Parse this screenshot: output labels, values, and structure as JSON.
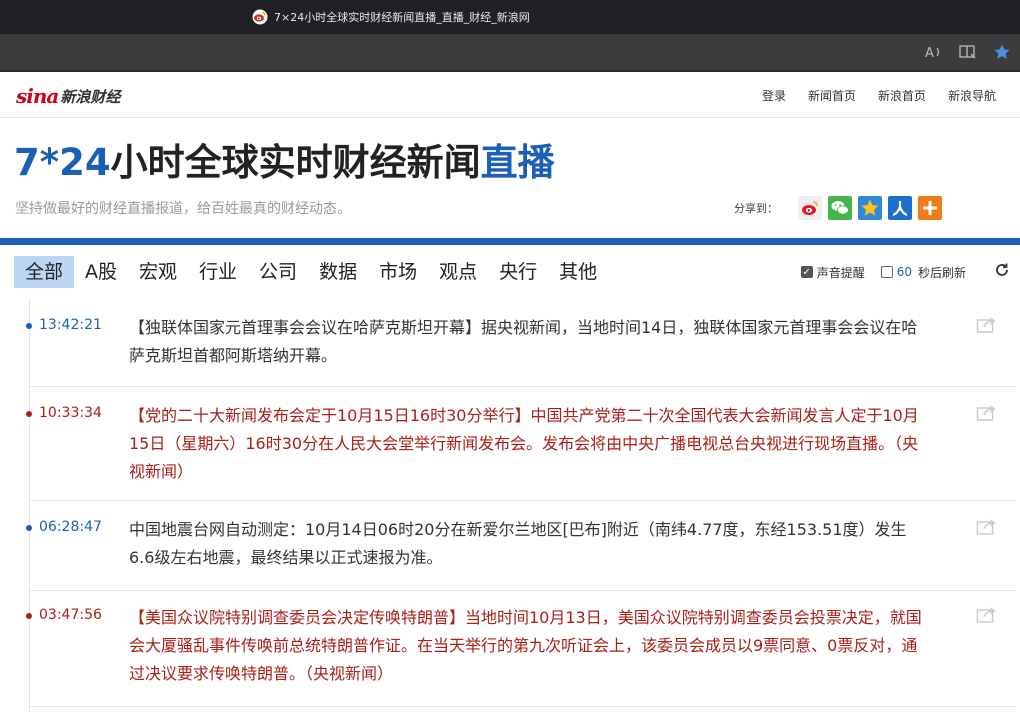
{
  "browser": {
    "tab_title": "7×24小时全球实时财经新闻直播_直播_财经_新浪网",
    "icons": [
      "read-aloud-icon",
      "immersive-reader-icon",
      "favorite-star-icon"
    ]
  },
  "header": {
    "logo_sina": "sina",
    "logo_text": "新浪财经",
    "nav": [
      "登录",
      "新闻首页",
      "新浪首页",
      "新浪导航"
    ]
  },
  "hero": {
    "title_part1": "7*24",
    "title_part2": "小时全球实时财经新闻",
    "title_part3": "直播",
    "subtitle": "坚持做最好的财经直播报道，给百姓最真的财经动态。",
    "share_label": "分享到：",
    "share_targets": [
      {
        "name": "weibo",
        "color": "#e8e8e8"
      },
      {
        "name": "wechat",
        "color": "#44b549"
      },
      {
        "name": "qzone",
        "color": "#2f8ad9"
      },
      {
        "name": "renren",
        "color": "#1f6fd0"
      },
      {
        "name": "more",
        "color": "#f27b1a"
      }
    ]
  },
  "filters": {
    "categories": [
      "全部",
      "A股",
      "宏观",
      "行业",
      "公司",
      "数据",
      "市场",
      "观点",
      "央行",
      "其他"
    ],
    "active_index": 0,
    "sound_label": "声音提醒",
    "sound_checked": true,
    "refresh_seconds": "60",
    "refresh_label": "秒后刷新",
    "refresh_checked": false
  },
  "colors": {
    "accent_blue": "#1b5fb7",
    "important_red": "#a8201a",
    "normal_text": "#333333"
  },
  "feed": [
    {
      "time": "13:42:21",
      "important": false,
      "text": "【独联体国家元首理事会会议在哈萨克斯坦开幕】据央视新闻，当地时间14日，独联体国家元首理事会会议在哈萨克斯坦首都阿斯塔纳开幕。"
    },
    {
      "time": "10:33:34",
      "important": true,
      "text": "【党的二十大新闻发布会定于10月15日16时30分举行】中国共产党第二十次全国代表大会新闻发言人定于10月15日（星期六）16时30分在人民大会堂举行新闻发布会。发布会将由中央广播电视总台央视进行现场直播。（央视新闻）"
    },
    {
      "time": "06:28:47",
      "important": false,
      "text": "中国地震台网自动测定：10月14日06时20分在新爱尔兰地区[巴布]附近（南纬4.77度，东经153.51度）发生6.6级左右地震，最终结果以正式速报为准。"
    },
    {
      "time": "03:47:56",
      "important": true,
      "text": "【美国众议院特别调查委员会决定传唤特朗普】当地时间10月13日，美国众议院特别调查委员会投票决定，就国会大厦骚乱事件传唤前总统特朗普作证。在当天举行的第九次听证会上，该委员会成员以9票同意、0票反对，通过决议要求传唤特朗普。（央视新闻）"
    }
  ]
}
